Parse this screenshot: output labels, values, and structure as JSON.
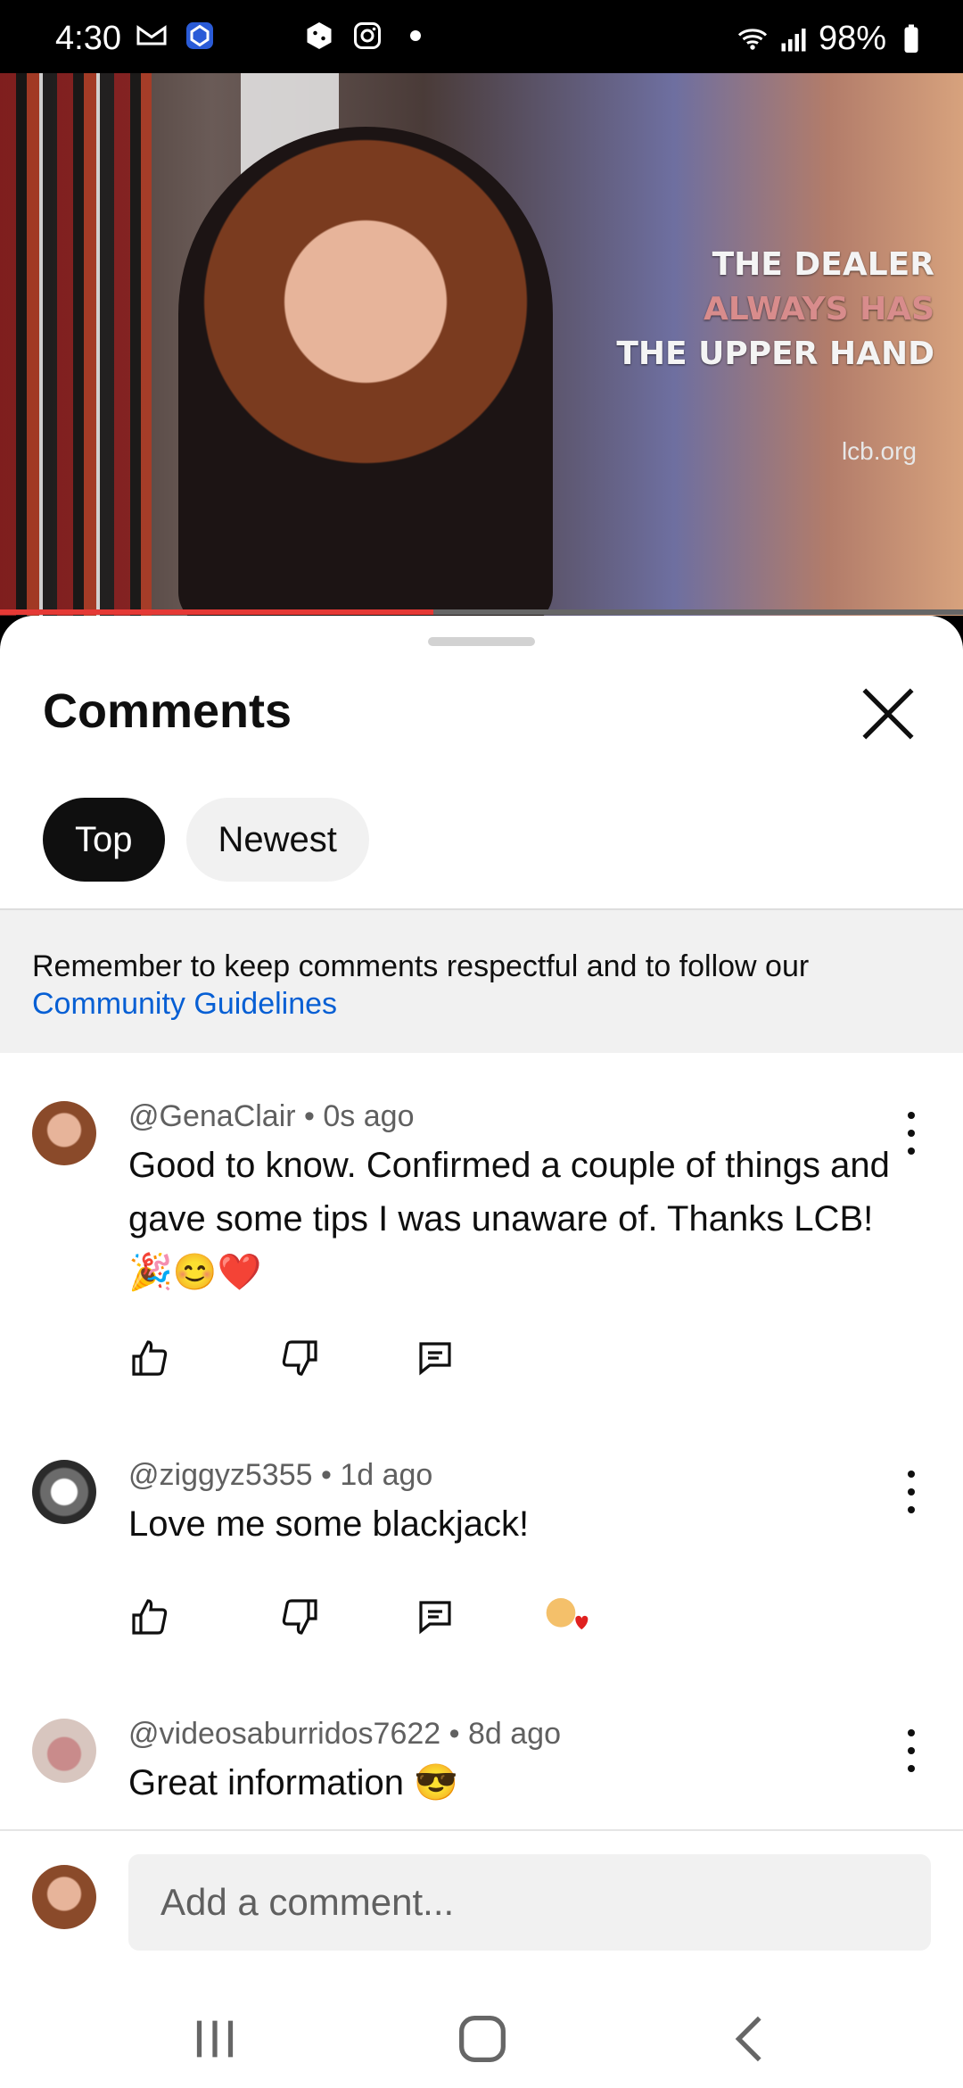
{
  "status_bar": {
    "time": "4:30",
    "battery": "98%"
  },
  "video": {
    "overlay_lines": [
      "THE DEALER",
      "ALWAYS HAS",
      "THE UPPER HAND"
    ],
    "watermark": "lcb.org",
    "progress_fraction": 0.45
  },
  "sheet": {
    "title": "Comments",
    "tabs": [
      {
        "label": "Top",
        "active": true
      },
      {
        "label": "Newest",
        "active": false
      }
    ],
    "notice": {
      "text": "Remember to keep comments respectful and to follow our",
      "link": "Community Guidelines"
    },
    "comments": [
      {
        "author": "@GenaClair",
        "time": "0s ago",
        "text": "Good to know. Confirmed a couple of things and gave some tips I was unaware of. Thanks LCB!🎉😊❤️"
      },
      {
        "author": "@ziggyz5355",
        "time": "1d ago",
        "text": "Love me some blackjack!"
      },
      {
        "author": "@videosaburridos7622",
        "time": "8d ago",
        "text": "Great information 😎"
      }
    ],
    "composer_placeholder": "Add a comment..."
  },
  "colors": {
    "accent_link": "#065fd4",
    "progress": "#e53935"
  }
}
